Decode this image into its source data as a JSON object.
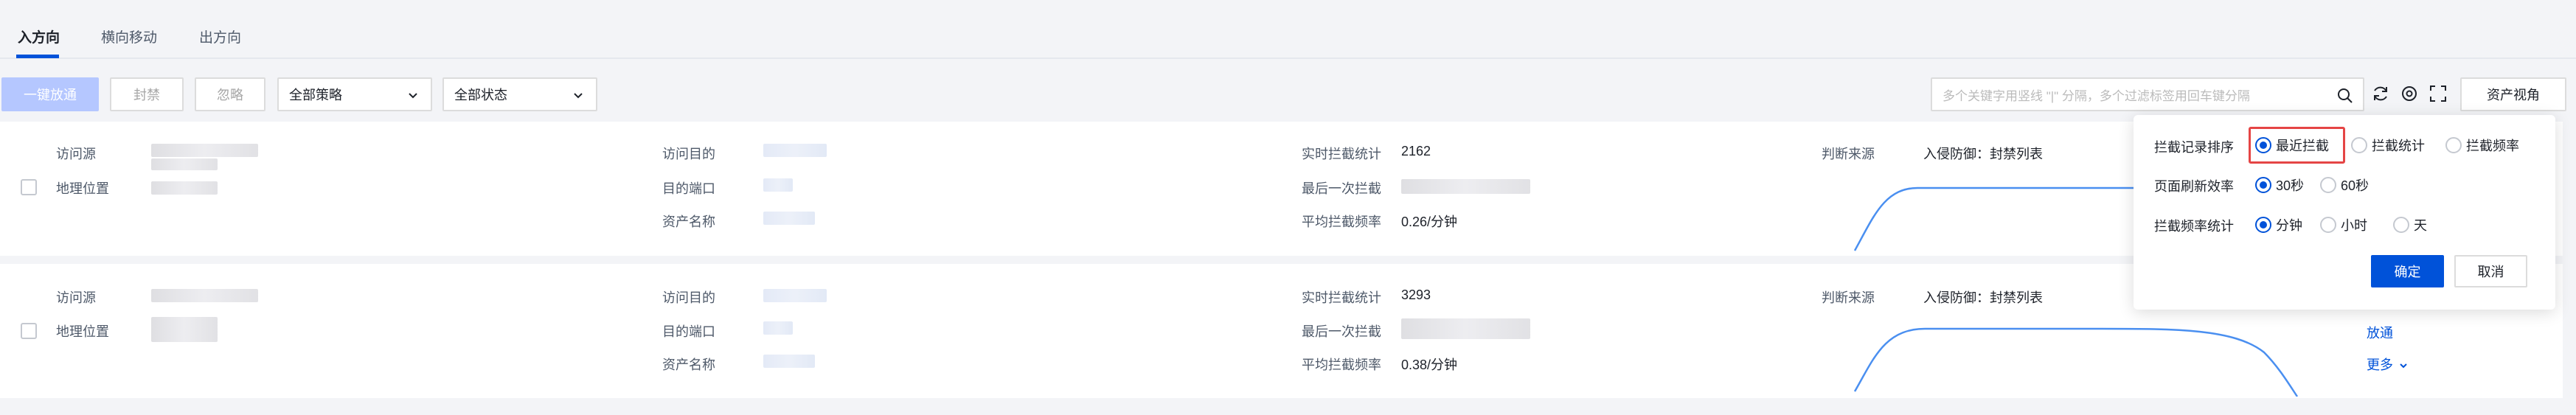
{
  "tabs": [
    {
      "label": "入方向",
      "active": true
    },
    {
      "label": "横向移动",
      "active": false
    },
    {
      "label": "出方向",
      "active": false
    }
  ],
  "toolbar": {
    "allow_all_label": "一键放通",
    "block_label": "封禁",
    "ignore_label": "忽略",
    "strategy_select": "全部策略",
    "status_select": "全部状态",
    "search_placeholder": "多个关键字用竖线 \"|\" 分隔，多个过滤标签用回车键分隔",
    "asset_view_label": "资产视角"
  },
  "labels": {
    "source": "访问源",
    "geo": "地理位置",
    "target": "访问目的",
    "port": "目的端口",
    "asset": "资产名称",
    "realtime_count": "实时拦截统计",
    "last_block": "最后一次拦截",
    "avg_rate": "平均拦截频率",
    "judge_source": "判断来源"
  },
  "rows": [
    {
      "realtime_count": "2162",
      "avg_rate": "0.26/分钟",
      "judge_source_value": "入侵防御：封禁列表"
    },
    {
      "realtime_count": "3293",
      "avg_rate": "0.38/分钟",
      "judge_source_value": "入侵防御：封禁列表",
      "action_allow": "放通",
      "action_more": "更多"
    }
  ],
  "popover": {
    "sort_label": "拦截记录排序",
    "sort_options": [
      "最近拦截",
      "拦截统计",
      "拦截频率"
    ],
    "refresh_label": "页面刷新效率",
    "refresh_options": [
      "30秒",
      "60秒"
    ],
    "freq_label": "拦截频率统计",
    "freq_options": [
      "分钟",
      "小时",
      "天"
    ],
    "confirm_label": "确定",
    "cancel_label": "取消"
  },
  "colors": {
    "accent": "#0052d9",
    "highlight": "#e54545"
  }
}
